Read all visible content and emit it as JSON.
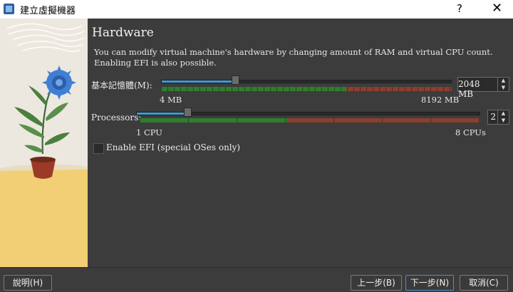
{
  "window": {
    "title": "建立虛擬機器",
    "help_label": "?",
    "close_label": "✕"
  },
  "hardware": {
    "heading": "Hardware",
    "description": "You can modify virtual machine's hardware by changing amount of RAM and virtual CPU count. Enabling EFI is also possible."
  },
  "memory": {
    "label": "基本記憶體(M):",
    "value": "2048 MB",
    "min_label": "4 MB",
    "max_label": "8192 MB",
    "min": 4,
    "max": 8192,
    "current": 2048
  },
  "processors": {
    "label": "Processors:",
    "value": "2",
    "min_label": "1 CPU",
    "max_label": "8 CPUs",
    "min": 1,
    "max": 8,
    "current": 2
  },
  "efi": {
    "label": "Enable EFI (special OSes only)",
    "checked": false
  },
  "buttons": {
    "help": "說明(H)",
    "back": "上一步(B)",
    "next": "下一步(N)",
    "cancel": "取消(C)"
  },
  "colors": {
    "background": "#3c3c3c",
    "slider_fill": "#3d9bd2",
    "safe_band": "#2f7d2d",
    "warn_band": "#8a3f2f",
    "illustration_sky": "#ece8df",
    "illustration_floor": "#f2cf74",
    "flower": "#3f7fd4"
  }
}
